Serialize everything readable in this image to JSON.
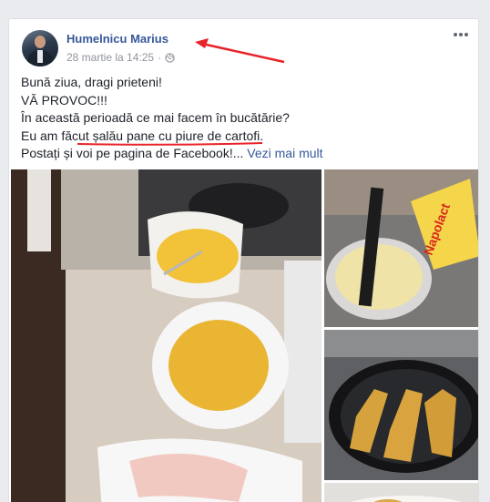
{
  "post": {
    "author": "Humelnicu Marius",
    "timestamp": "28 martie la 14:25",
    "privacy_icon": "globe-icon",
    "options_icon": "more-options-icon",
    "lines": [
      "Bună ziua, dragi prieteni!",
      "VĂ PROVOC!!!",
      "În această perioadă ce mai facem în bucătărie?",
      "Eu am făcut șalău pane cu piure de cartofi.",
      "Postați și voi pe pagina de Facebook!..."
    ],
    "see_more": "Vezi mai mult"
  },
  "photos": {
    "side_top_brand": "Napolact"
  },
  "colors": {
    "link": "#365899",
    "annotation": "#e8242a",
    "background": "#e9ebee"
  }
}
